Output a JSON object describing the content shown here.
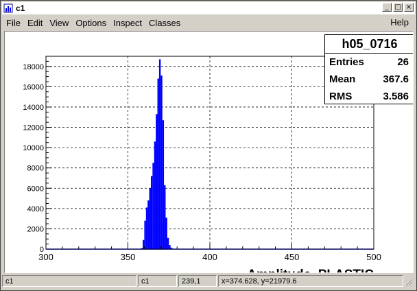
{
  "window": {
    "title": "c1"
  },
  "title_buttons": {
    "minimize": "_",
    "maximize": "□",
    "close": "×"
  },
  "menu": {
    "items": [
      "File",
      "Edit",
      "View",
      "Options",
      "Inspect",
      "Classes"
    ],
    "help": "Help"
  },
  "stats": {
    "name": "h05_0716",
    "rows": [
      {
        "label": "Entries",
        "value": "26"
      },
      {
        "label": "Mean",
        "value": "367.6"
      },
      {
        "label": "RMS",
        "value": "3.586"
      }
    ]
  },
  "status": {
    "cells": [
      "c1",
      "c1",
      "239,1",
      "x=374.628, y=21979.6"
    ]
  },
  "chart_data": {
    "type": "bar",
    "xlabel": "Amplitude_PLASTIC",
    "xlim": [
      300,
      500
    ],
    "ylim": [
      0,
      19000
    ],
    "x_ticks": [
      "300",
      "350",
      "400",
      "450",
      "500"
    ],
    "y_ticks": [
      "0",
      "2000",
      "4000",
      "6000",
      "8000",
      "10000",
      "12000",
      "14000",
      "16000",
      "18000"
    ],
    "grid": true,
    "bar_color": "#0000ff",
    "bin_width": 1,
    "bins": [
      {
        "x": 358,
        "y": 100
      },
      {
        "x": 359,
        "y": 900
      },
      {
        "x": 360,
        "y": 2800
      },
      {
        "x": 361,
        "y": 4100
      },
      {
        "x": 362,
        "y": 4800
      },
      {
        "x": 363,
        "y": 6000
      },
      {
        "x": 364,
        "y": 7200
      },
      {
        "x": 365,
        "y": 8500
      },
      {
        "x": 366,
        "y": 10600
      },
      {
        "x": 367,
        "y": 13300
      },
      {
        "x": 368,
        "y": 16800
      },
      {
        "x": 369,
        "y": 18700
      },
      {
        "x": 370,
        "y": 17100
      },
      {
        "x": 371,
        "y": 12700
      },
      {
        "x": 372,
        "y": 6300
      },
      {
        "x": 373,
        "y": 3100
      },
      {
        "x": 374,
        "y": 1100
      },
      {
        "x": 375,
        "y": 400
      },
      {
        "x": 376,
        "y": 150
      },
      {
        "x": 377,
        "y": 60
      }
    ]
  }
}
